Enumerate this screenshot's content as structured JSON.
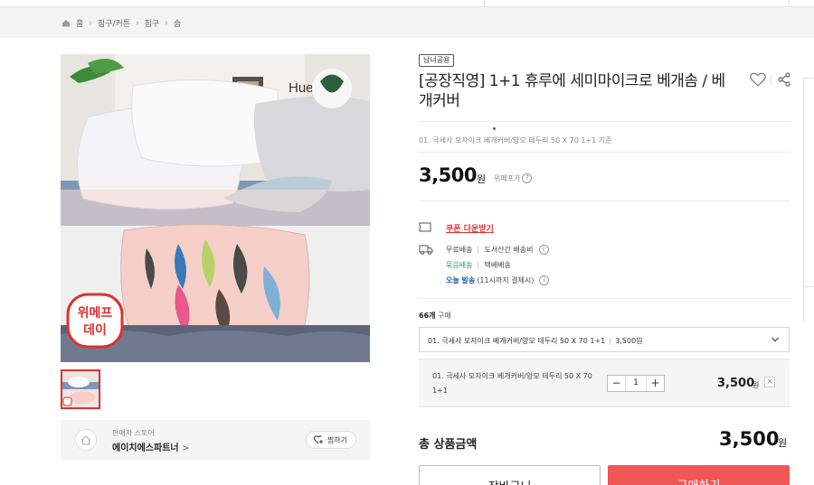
{
  "breadcrumb": {
    "items": [
      "홈",
      "침구/커튼",
      "침구",
      "솜"
    ]
  },
  "image": {
    "brand_text": "Hueruhe",
    "sticker_line1": "위메프",
    "sticker_line2": "데이"
  },
  "seller": {
    "label": "판매자 스토어",
    "name": "에이치에스파트너",
    "name_suffix": ">",
    "bookmark_label": "찜하기"
  },
  "product": {
    "badge": "남녀공용",
    "title": "[공장직영] 1+1 휴루에 세미마이크로 베개솜 / 베개커버",
    "option_subtitle": "01. 극세사 모자이크 베개커버/양모 테두리 50 X 70 1+1 기준",
    "price": "3,500",
    "price_unit": "원",
    "price_note": "위메프가",
    "price_help": "?"
  },
  "coupon": {
    "label": "쿠폰 다운받기"
  },
  "shipping": {
    "free": "무료배송",
    "island": "도서산간 배송비",
    "bundle": "묶음배송",
    "courier": "택배배송",
    "today": "오늘 발송",
    "today_note": "(11시까지 결제시)",
    "info": "i"
  },
  "purchase": {
    "count": "66개",
    "count_suffix": "구매"
  },
  "option_select": {
    "selected": "01. 극세사 모자이크 베개커버/양모 테두리 50 X 70 1+1",
    "price": "3,500원"
  },
  "selected_item": {
    "name": "01. 극세사 모자이크 베개커버/양모 테두리 50 X 70 1+1",
    "qty_minus": "−",
    "qty_value": "1",
    "qty_plus": "+",
    "price": "3,500",
    "price_unit": "원",
    "remove": "×"
  },
  "total": {
    "label": "총 상품금액",
    "price": "3,500",
    "price_unit": "원"
  },
  "actions": {
    "cart": "장바구니",
    "buy": "구매하기"
  },
  "colors": {
    "accent_red": "#e03030",
    "buy_button": "#f05656",
    "bundle_green": "#1aa260",
    "today_blue": "#2060c0"
  }
}
